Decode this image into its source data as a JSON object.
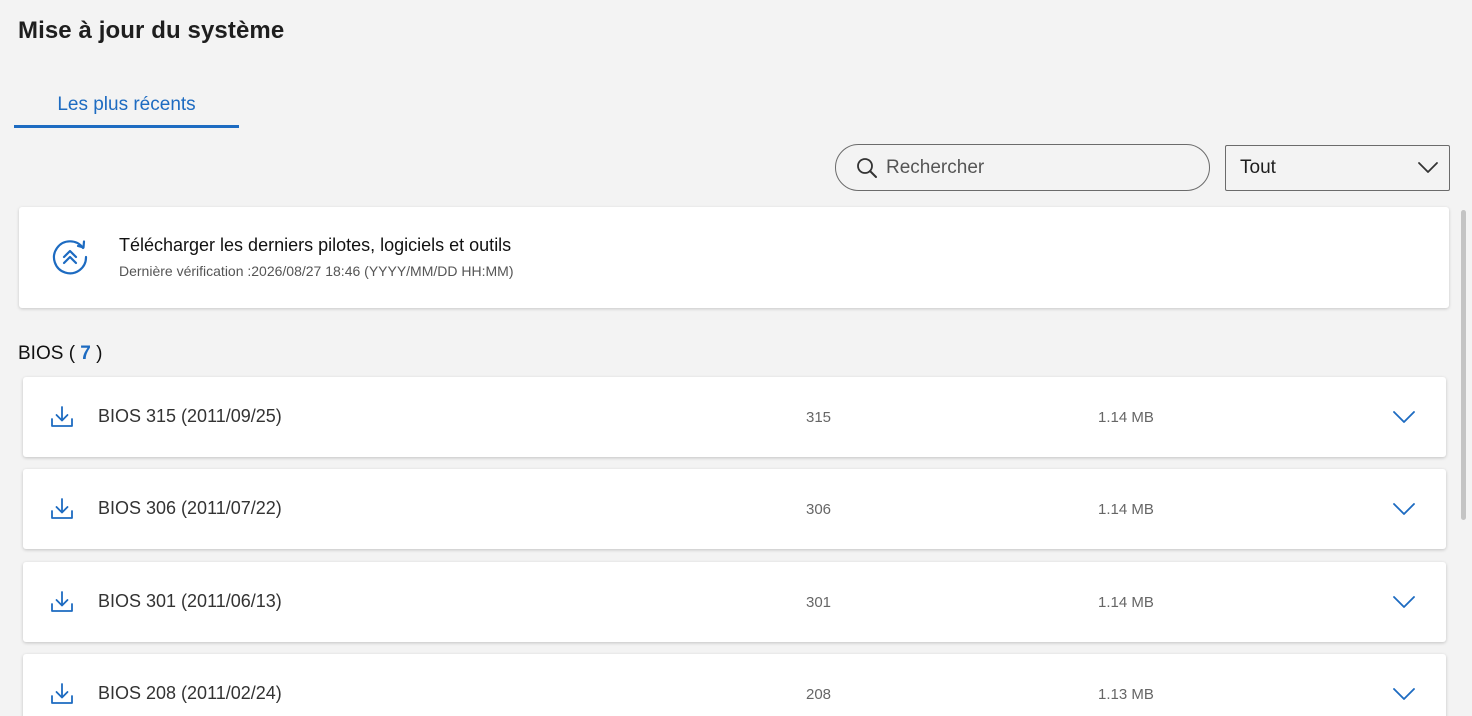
{
  "page": {
    "title": "Mise à jour du système"
  },
  "tabs": [
    {
      "label": "Les plus récents",
      "active": true
    }
  ],
  "search": {
    "placeholder": "Rechercher",
    "value": ""
  },
  "filter": {
    "selected": "Tout"
  },
  "update_card": {
    "title": "Télécharger les derniers pilotes, logiciels et outils",
    "subtitle": "Dernière vérification :2026/08/27 18:46 (YYYY/MM/DD HH:MM)"
  },
  "section": {
    "label": "BIOS",
    "open_paren": "(",
    "count": "7",
    "close_paren": ")"
  },
  "items": [
    {
      "name": "BIOS 315 (2011/09/25)",
      "version": "315",
      "size": "1.14 MB"
    },
    {
      "name": "BIOS 306 (2011/07/22)",
      "version": "306",
      "size": "1.14 MB"
    },
    {
      "name": "BIOS 301 (2011/06/13)",
      "version": "301",
      "size": "1.14 MB"
    },
    {
      "name": "BIOS 208 (2011/02/24)",
      "version": "208",
      "size": "1.13 MB"
    }
  ],
  "colors": {
    "accent": "#1d6bc1",
    "background": "#f3f3f3",
    "card": "#ffffff"
  },
  "icons": {
    "search": "search-icon",
    "dropdown": "chevron-down-icon",
    "update": "update-refresh-icon",
    "download": "download-icon",
    "expand": "chevron-down-icon"
  }
}
